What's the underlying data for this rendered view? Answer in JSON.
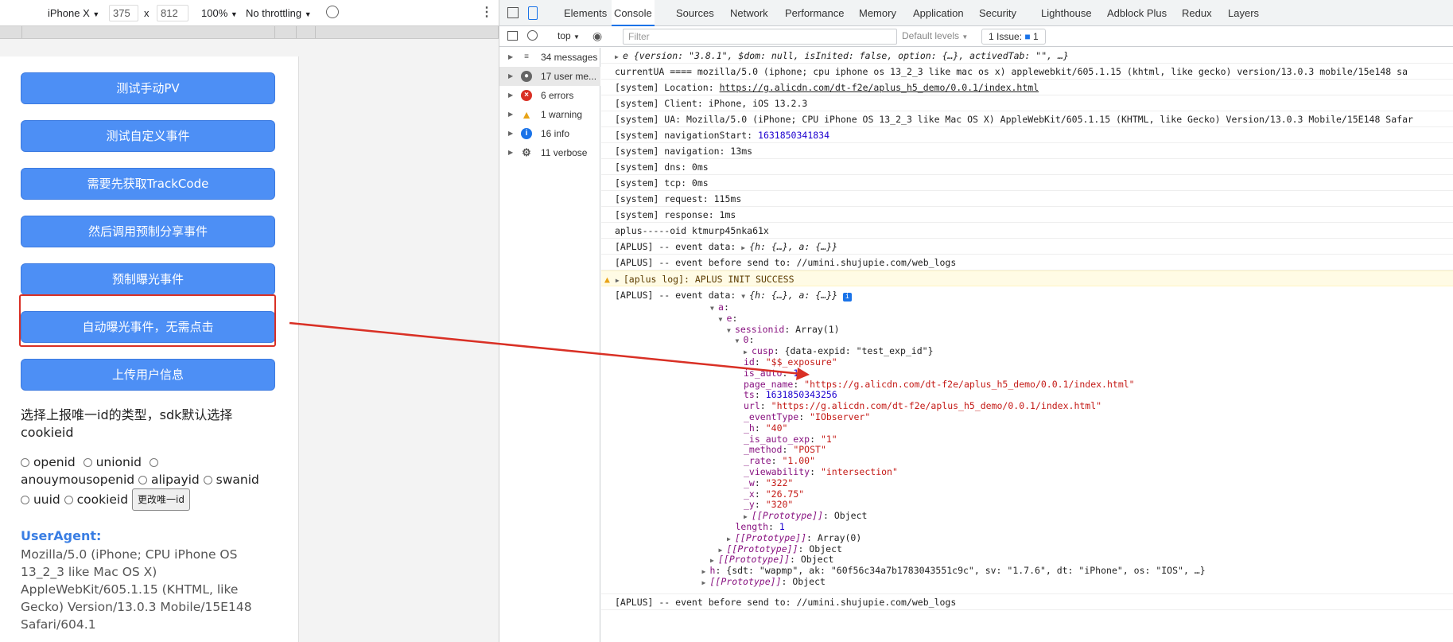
{
  "device_toolbar": {
    "device": "iPhone X",
    "width": "375",
    "times": "x",
    "height": "812",
    "zoom": "100%",
    "throttle": "No throttling"
  },
  "phone": {
    "buttons": [
      "测试手动PV",
      "测试自定义事件",
      "需要先获取TrackCode",
      "然后调用预制分享事件",
      "预制曝光事件",
      "自动曝光事件，无需点击",
      "上传用户信息"
    ],
    "select_text_1": "选择上报唯一id的类型，sdk默认选择",
    "select_text_2": "cookieid",
    "radios": [
      "openid",
      "unionid",
      "anouymousopenid",
      "alipayid",
      "swanid",
      "uuid",
      "cookieid"
    ],
    "change_button": "更改唯一id",
    "ua_label": "UserAgent:",
    "ua_lines": [
      "Mozilla/5.0 (iPhone; CPU iPhone OS",
      "13_2_3 like Mac OS X)",
      "AppleWebKit/605.1.15 (KHTML, like",
      "Gecko) Version/13.0.3 Mobile/15E148",
      "Safari/604.1"
    ]
  },
  "devtools": {
    "tabs": [
      "Elements",
      "Console",
      "Sources",
      "Network",
      "Performance",
      "Memory",
      "Application",
      "Security",
      "Lighthouse",
      "Adblock Plus",
      "Redux",
      "Layers"
    ],
    "active_tab": "Console",
    "context": "top",
    "filter_placeholder": "Filter",
    "levels": "Default levels",
    "issues": "1 Issue:",
    "issues_count": "1"
  },
  "sidebar": [
    {
      "label": "34 messages",
      "icon": "list-icon"
    },
    {
      "label": "17 user me...",
      "icon": "user-icon"
    },
    {
      "label": "6 errors",
      "icon": "error-icon"
    },
    {
      "label": "1 warning",
      "icon": "warning-icon"
    },
    {
      "label": "16 info",
      "icon": "info-icon"
    },
    {
      "label": "11 verbose",
      "icon": "gear-icon"
    }
  ],
  "console": {
    "colors": {
      "key": "#881280",
      "string": "#c41a16",
      "number": "#1c00cf"
    },
    "r0": "e {version: \"3.8.1\", $dom: null, isInited: false, option: {…}, activedTab: \"\", …}",
    "r1": "currentUA ====  mozilla/5.0 (iphone; cpu iphone os 13_2_3 like mac os x) applewebkit/605.1.15 (khtml, like gecko) version/13.0.3 mobile/15e148 sa",
    "r2a": "[system] Location: ",
    "r2b": "https://g.alicdn.com/dt-f2e/aplus_h5_demo/0.0.1/index.html",
    "r3": "[system] Client: iPhone, iOS 13.2.3",
    "r4": "[system] UA: Mozilla/5.0 (iPhone; CPU iPhone OS 13_2_3 like Mac OS X) AppleWebKit/605.1.15 (KHTML, like Gecko) Version/13.0.3 Mobile/15E148 Safar",
    "r5a": "[system] navigationStart: ",
    "r5b": "1631850341834",
    "r6": "[system] navigation: 13ms",
    "r7": "[system] dns: 0ms",
    "r8": "[system] tcp: 0ms",
    "r9": "[system] request: 115ms",
    "r10": "[system] response: 1ms",
    "r11": "aplus-----oid ktmurp45nka61x",
    "r12a": "[APLUS] -- event data:  ",
    "r12b": "{h: {…}, a: {…}}",
    "r13": "[APLUS] -- event before send to:  //umini.shujupie.com/web_logs",
    "r14": "[aplus log]: APLUS INIT SUCCESS",
    "r15a": "[APLUS] -- event data:  ",
    "r15b": "{h: {…}, a: {…}}",
    "tree": [
      {
        "k": "a",
        "v": ""
      },
      {
        "k": "e",
        "v": ""
      },
      {
        "k": "sessionid",
        "v": "Array(1)"
      },
      {
        "k": "0",
        "v": ""
      },
      {
        "k": "cusp",
        "v": "{data-expid: \"test_exp_id\"}"
      },
      {
        "k": "id",
        "v": "\"$$_exposure\""
      },
      {
        "k": "is_auto",
        "v": "1"
      },
      {
        "k": "page_name",
        "v": "\"https://g.alicdn.com/dt-f2e/aplus_h5_demo/0.0.1/index.html\""
      },
      {
        "k": "ts",
        "v": "1631850343256"
      },
      {
        "k": "url",
        "v": "\"https://g.alicdn.com/dt-f2e/aplus_h5_demo/0.0.1/index.html\""
      },
      {
        "k": "_eventType",
        "v": "\"IObserver\""
      },
      {
        "k": "_h",
        "v": "\"40\""
      },
      {
        "k": "_is_auto_exp",
        "v": "\"1\""
      },
      {
        "k": "_method",
        "v": "\"POST\""
      },
      {
        "k": "_rate",
        "v": "\"1.00\""
      },
      {
        "k": "_viewability",
        "v": "\"intersection\""
      },
      {
        "k": "_w",
        "v": "\"322\""
      },
      {
        "k": "_x",
        "v": "\"26.75\""
      },
      {
        "k": "_y",
        "v": "\"320\""
      },
      {
        "k": "[[Prototype]]",
        "v": "Object"
      },
      {
        "k": "length",
        "v": "1"
      },
      {
        "k": "[[Prototype]]",
        "v": "Array(0)"
      },
      {
        "k": "[[Prototype]]",
        "v": "Object"
      },
      {
        "k": "[[Prototype]]",
        "v": "Object"
      },
      {
        "k": "h",
        "v": "{sdt: \"wapmp\", ak: \"60f56c34a7b1783043551c9c\", sv: \"1.7.6\", dt: \"iPhone\", os: \"IOS\", …}"
      },
      {
        "k": "[[Prototype]]",
        "v": "Object"
      }
    ],
    "r_last": "[APLUS] -- event before send to: //umini.shujupie.com/web_logs"
  },
  "annotation_color": "#d93025"
}
